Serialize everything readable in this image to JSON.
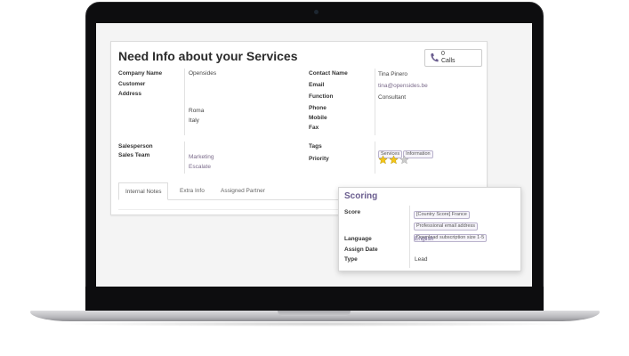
{
  "record": {
    "title": "Need Info about your Services",
    "calls": {
      "count": "0",
      "label": "Calls"
    },
    "left_fields": [
      {
        "label": "Company Name",
        "value": "Opensides"
      },
      {
        "label": "Customer",
        "value": ""
      },
      {
        "label": "Address",
        "value": ""
      }
    ],
    "address_lines": [
      "Roma",
      "Italy"
    ],
    "contact_fields": {
      "contact_name_label": "Contact Name",
      "contact_name": "Tina Pinero",
      "email_label": "Email",
      "email": "tina@opensides.be",
      "function_label": "Function",
      "function": "Consultant",
      "phone_label": "Phone",
      "mobile_label": "Mobile",
      "fax_label": "Fax"
    },
    "sales": {
      "salesperson_label": "Salesperson",
      "sales_team_label": "Sales Team",
      "sales_team_lines": [
        "Marketing",
        "Escalate"
      ]
    },
    "tags_label": "Tags",
    "tags": [
      "Services",
      "Information"
    ],
    "priority_label": "Priority",
    "priority": {
      "filled": 2,
      "max": 3
    },
    "tabs": [
      "Internal Notes",
      "Extra Info",
      "Assigned Partner"
    ]
  },
  "scoring": {
    "title": "Scoring",
    "score_label": "Score",
    "score_tags": [
      "[Country Score] France",
      "Professional email address",
      "Download subscription size 1-5"
    ],
    "language_label": "Language",
    "language": "English",
    "assign_date_label": "Assign Date",
    "assign_date": "",
    "type_label": "Type",
    "type": "Lead"
  },
  "colors": {
    "accent": "#6a5d8f",
    "star_filled": "#f5c518",
    "star_empty": "#cccccc"
  },
  "icons": {
    "calls": "phone-icon",
    "priority": "star-icon"
  }
}
